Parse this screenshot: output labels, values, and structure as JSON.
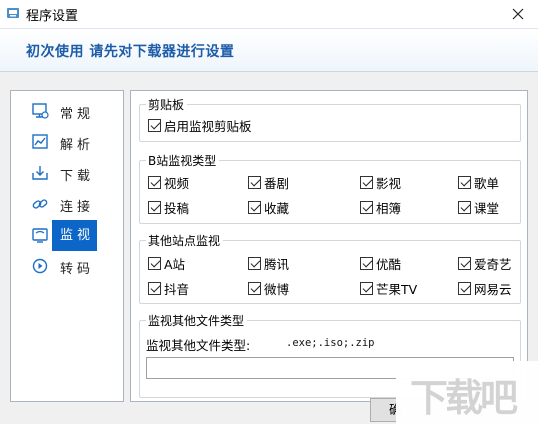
{
  "window": {
    "title": "程序设置"
  },
  "header": {
    "text": "初次使用  请先对下载器进行设置"
  },
  "sidebar": {
    "items": [
      {
        "label": "常规",
        "icon": "monitor-settings-icon"
      },
      {
        "label": "解析",
        "icon": "chart-icon"
      },
      {
        "label": "下载",
        "icon": "download-icon"
      },
      {
        "label": "连接",
        "icon": "link-icon"
      },
      {
        "label": "监视",
        "icon": "monitor-icon",
        "selected": true
      },
      {
        "label": "转码",
        "icon": "convert-icon"
      }
    ]
  },
  "clipboard_group": {
    "title": "剪贴板",
    "enable_label": "启用监视剪贴板",
    "enable_checked": true
  },
  "bilibili_group": {
    "title": "B站监视类型",
    "items": [
      {
        "label": "视频",
        "checked": true
      },
      {
        "label": "番剧",
        "checked": true
      },
      {
        "label": "影视",
        "checked": true
      },
      {
        "label": "歌单",
        "checked": true
      },
      {
        "label": "投稿",
        "checked": true
      },
      {
        "label": "收藏",
        "checked": true
      },
      {
        "label": "相簿",
        "checked": true
      },
      {
        "label": "课堂",
        "checked": true
      }
    ]
  },
  "other_sites_group": {
    "title": "其他站点监视",
    "items": [
      {
        "label": "A站",
        "checked": true
      },
      {
        "label": "腾讯",
        "checked": true
      },
      {
        "label": "优酷",
        "checked": true
      },
      {
        "label": "爱奇艺",
        "checked": true
      },
      {
        "label": "抖音",
        "checked": true
      },
      {
        "label": "微博",
        "checked": true
      },
      {
        "label": "芒果TV",
        "checked": true
      },
      {
        "label": "网易云",
        "checked": true
      }
    ]
  },
  "other_files_group": {
    "title": "监视其他文件类型",
    "field_label": "监视其他文件类型:",
    "field_value": ".exe;.iso;.zip",
    "input_value": ""
  },
  "buttons": {
    "confirm_label": "确"
  },
  "watermark": {
    "text": "下载吧"
  },
  "colors": {
    "accent": "#0b66c7",
    "header_text": "#1d5ca8"
  }
}
